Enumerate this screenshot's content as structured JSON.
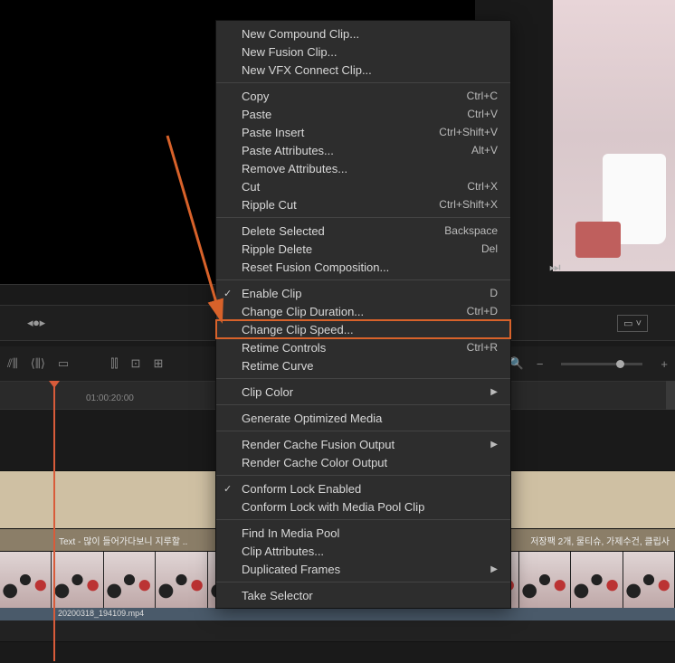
{
  "viewer": {},
  "transport": {
    "skip_next": "⏭"
  },
  "toolbar": {
    "timecode": "01:00:20:00"
  },
  "tracks": {
    "text_clip_label": "Text - 많이 들어가다보니 지루할 ..",
    "text_clip_right": "저장팩 2개, 물티슈, 가제수건, 클립사",
    "filename": "20200318_194109.mp4"
  },
  "menu": {
    "groups": [
      [
        {
          "label": "New Compound Clip..."
        },
        {
          "label": "New Fusion Clip..."
        },
        {
          "label": "New VFX Connect Clip..."
        }
      ],
      [
        {
          "label": "Copy",
          "shortcut": "Ctrl+C"
        },
        {
          "label": "Paste",
          "shortcut": "Ctrl+V"
        },
        {
          "label": "Paste Insert",
          "shortcut": "Ctrl+Shift+V"
        },
        {
          "label": "Paste Attributes...",
          "shortcut": "Alt+V"
        },
        {
          "label": "Remove Attributes..."
        },
        {
          "label": "Cut",
          "shortcut": "Ctrl+X"
        },
        {
          "label": "Ripple Cut",
          "shortcut": "Ctrl+Shift+X"
        }
      ],
      [
        {
          "label": "Delete Selected",
          "shortcut": "Backspace"
        },
        {
          "label": "Ripple Delete",
          "shortcut": "Del"
        },
        {
          "label": "Reset Fusion Composition..."
        }
      ],
      [
        {
          "label": "Enable Clip",
          "shortcut": "D",
          "checked": true
        },
        {
          "label": "Change Clip Duration...",
          "shortcut": "Ctrl+D"
        },
        {
          "label": "Change Clip Speed...",
          "highlight": true
        },
        {
          "label": "Retime Controls",
          "shortcut": "Ctrl+R"
        },
        {
          "label": "Retime Curve"
        }
      ],
      [
        {
          "label": "Clip Color",
          "submenu": true
        }
      ],
      [
        {
          "label": "Generate Optimized Media"
        }
      ],
      [
        {
          "label": "Render Cache Fusion Output",
          "submenu": true
        },
        {
          "label": "Render Cache Color Output"
        }
      ],
      [
        {
          "label": "Conform Lock Enabled",
          "checked": true
        },
        {
          "label": "Conform Lock with Media Pool Clip"
        }
      ],
      [
        {
          "label": "Find In Media Pool"
        },
        {
          "label": "Clip Attributes..."
        },
        {
          "label": "Duplicated Frames",
          "submenu": true
        }
      ],
      [
        {
          "label": "Take Selector"
        }
      ]
    ]
  },
  "annotation": {
    "highlight_item": "Change Clip Speed..."
  }
}
